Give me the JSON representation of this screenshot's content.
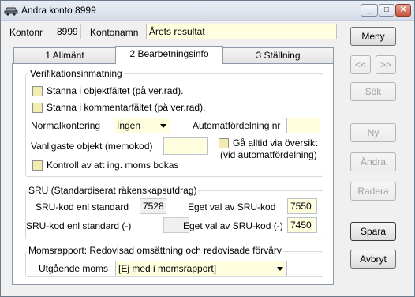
{
  "window": {
    "title": "Ändra konto 8999",
    "icon": "car-icon",
    "controls": {
      "minimize": "_",
      "maximize": "□",
      "close": "✕"
    }
  },
  "header": {
    "kontonr_label": "Kontonr",
    "kontonr_value": "8999",
    "kontonamn_label": "Kontonamn",
    "kontonamn_value": "Årets resultat"
  },
  "tabs": [
    {
      "label": "1 Allmänt",
      "active": false
    },
    {
      "label": "2 Bearbetningsinfo",
      "active": true
    },
    {
      "label": "3 Ställning",
      "active": false
    }
  ],
  "verifikation": {
    "title": "Verifikationsinmatning",
    "stanna_objekt": "Stanna i objektfältet (på ver.rad).",
    "stanna_kommentar": "Stanna i kommentarfältet (på ver.rad).",
    "normalkontering_label": "Normalkontering",
    "normalkontering_value": "Ingen",
    "automatfordelning_label": "Automatfördelning nr",
    "automatfordelning_value": "",
    "vanligaste_objekt_label": "Vanligaste objekt (memokod)",
    "vanligaste_objekt_value": "",
    "ga_alltid_line1": "Gå alltid via översikt",
    "ga_alltid_line2": "(vid automatfördelning)",
    "kontroll_moms": "Kontroll av att ing. moms bokas"
  },
  "sru": {
    "title": "SRU (Standardiserat räkenskapsutdrag)",
    "enl_standard_label": "SRU-kod enl standard",
    "enl_standard_value": "7528",
    "eget_val_label": "Eget val av SRU-kod",
    "eget_val_value": "7550",
    "enl_standard_neg_label": "SRU-kod enl standard (-)",
    "enl_standard_neg_value": "",
    "eget_val_neg_label": "Eget val av SRU-kod (-)",
    "eget_val_neg_value": "7450"
  },
  "moms": {
    "title": "Momsrapport: Redovisad omsättning och redovisade förvärv",
    "utgaende_label": "Utgående moms",
    "utgaende_value": "[Ej med i momsrapport]"
  },
  "buttons": {
    "meny": "Meny",
    "prev": "<<",
    "next": ">>",
    "sok": "Sök",
    "ny": "Ny",
    "andra": "Ändra",
    "radera": "Radera",
    "spara": "Spara",
    "avbryt": "Avbryt"
  }
}
